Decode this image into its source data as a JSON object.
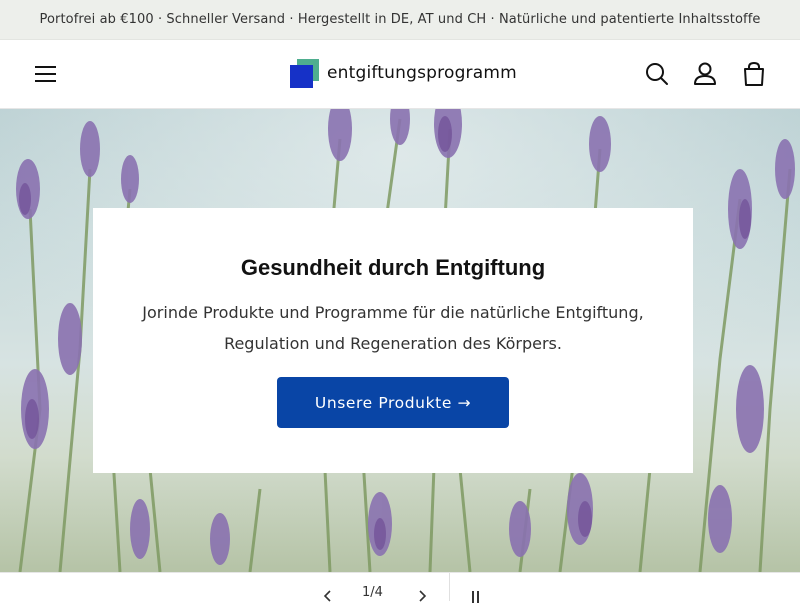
{
  "announcement": {
    "text": "Portofrei ab €100 · Schneller Versand · Hergestellt in DE, AT und CH · Natürliche und patentierte Inhaltsstoffe"
  },
  "header": {
    "logo_text": "entgiftungsprogramm",
    "icons": [
      "menu-icon",
      "search-icon",
      "account-icon",
      "cart-icon"
    ]
  },
  "hero": {
    "title": "Gesundheit durch Entgiftung",
    "text_line1": "Jorinde Produkte und Programme für die natürliche Entgiftung,",
    "text_line2": "Regulation und Regeneration des Körpers.",
    "cta_label": "Unsere Produkte →"
  },
  "slider": {
    "counter": "1/4",
    "icons": [
      "chevron-left-icon",
      "chevron-right-icon",
      "pause-icon"
    ]
  },
  "colors": {
    "brand_blue": "#0945a6",
    "logo_green": "#4fae8f",
    "logo_blue": "#1631c7",
    "announcement_bg": "#edefeb"
  }
}
